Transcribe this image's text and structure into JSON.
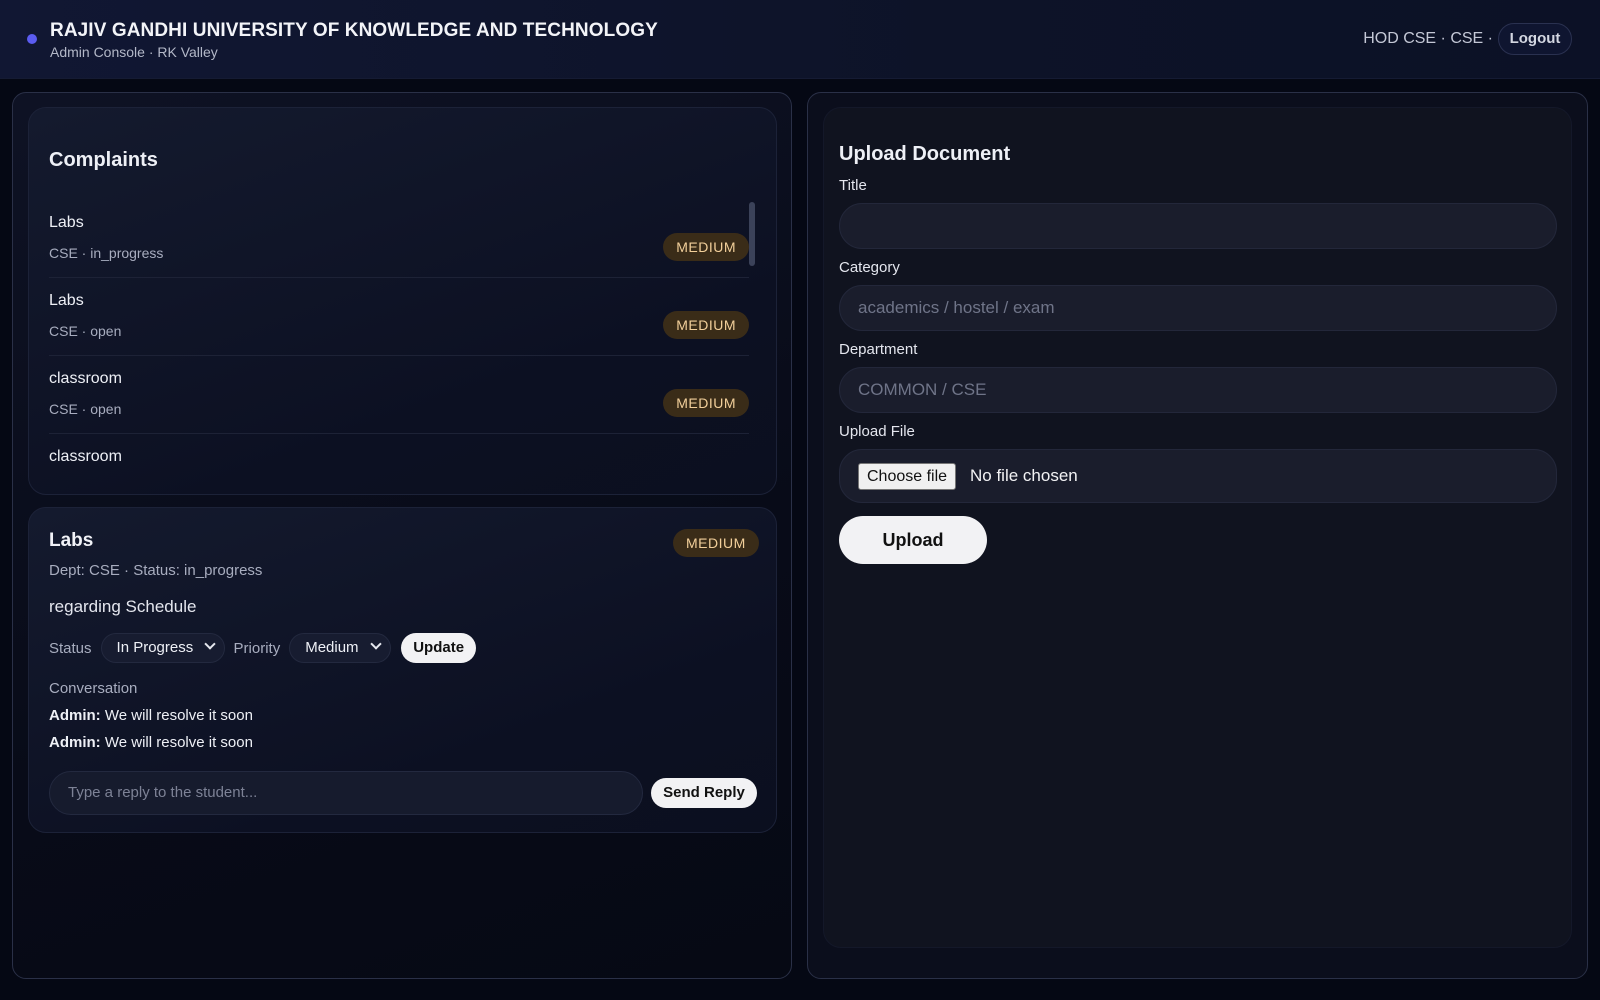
{
  "header": {
    "title": "RAJIV GANDHI UNIVERSITY OF KNOWLEDGE AND TECHNOLOGY",
    "subtitle": "Admin Console · RK Valley",
    "user": "HOD CSE · CSE ·",
    "logout_label": "Logout",
    "accent_color": "#5b5cf0"
  },
  "complaints": {
    "heading": "Complaints",
    "items": [
      {
        "title": "Labs",
        "meta": "CSE · in_progress",
        "priority": "MEDIUM"
      },
      {
        "title": "Labs",
        "meta": "CSE · open",
        "priority": "MEDIUM"
      },
      {
        "title": "classroom",
        "meta": "CSE · open",
        "priority": "MEDIUM"
      },
      {
        "title": "classroom",
        "meta": "",
        "priority": ""
      }
    ]
  },
  "detail": {
    "title": "Labs",
    "priority": "MEDIUM",
    "meta": "Dept: CSE · Status: in_progress",
    "body": "regarding Schedule",
    "status_label": "Status",
    "status_value": "In Progress",
    "priority_label": "Priority",
    "priority_value": "Medium",
    "update_label": "Update",
    "conversation_label": "Conversation",
    "messages": [
      {
        "author": "Admin:",
        "text": "We will resolve it soon"
      },
      {
        "author": "Admin:",
        "text": "We will resolve it soon"
      }
    ],
    "reply_placeholder": "Type a reply to the student...",
    "send_label": "Send Reply"
  },
  "upload": {
    "heading": "Upload Document",
    "title_label": "Title",
    "title_value": "",
    "category_label": "Category",
    "category_placeholder": "academics / hostel / exam",
    "department_label": "Department",
    "department_placeholder": "COMMON / CSE",
    "file_label": "Upload File",
    "choose_file_label": "Choose file",
    "no_file_text": "No file chosen",
    "upload_label": "Upload"
  }
}
